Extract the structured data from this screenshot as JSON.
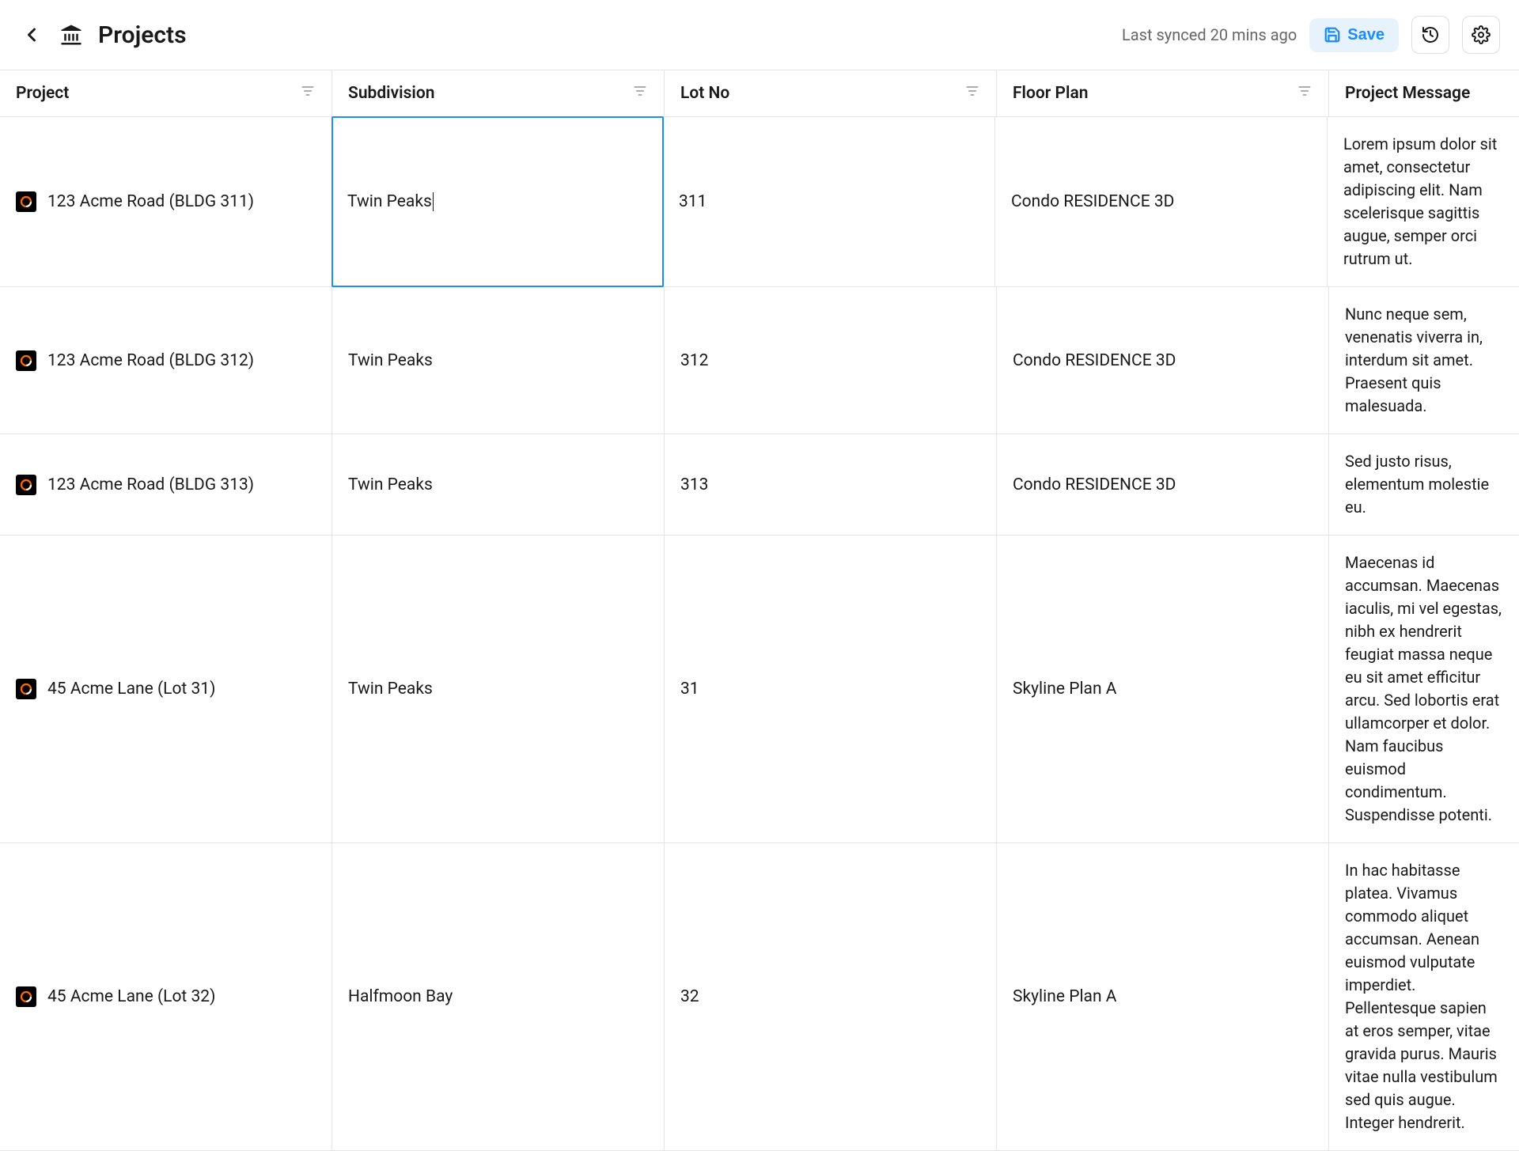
{
  "header": {
    "title": "Projects",
    "sync_text": "Last synced 20 mins ago",
    "save_label": "Save"
  },
  "columns": {
    "project": "Project",
    "subdivision": "Subdivision",
    "lotno": "Lot No",
    "floorplan": "Floor Plan",
    "message": "Project Message"
  },
  "rows": [
    {
      "project": "123 Acme Road (BLDG 311)",
      "subdivision": "Twin Peaks",
      "lotno": "311",
      "floorplan": "Condo RESIDENCE 3D",
      "message": "Lorem ipsum dolor sit amet, consectetur adipiscing elit. Nam scelerisque sagittis augue, semper orci rutrum ut."
    },
    {
      "project": "123 Acme Road (BLDG 312)",
      "subdivision": "Twin Peaks",
      "lotno": "312",
      "floorplan": "Condo RESIDENCE 3D",
      "message": "Nunc neque sem, venenatis viverra in, interdum sit amet. Praesent quis malesuada."
    },
    {
      "project": "123 Acme Road (BLDG 313)",
      "subdivision": "Twin Peaks",
      "lotno": "313",
      "floorplan": "Condo RESIDENCE 3D",
      "message": "Sed justo risus, elementum molestie eu."
    },
    {
      "project": "45 Acme Lane (Lot 31)",
      "subdivision": "Twin Peaks",
      "lotno": "31",
      "floorplan": "Skyline Plan A",
      "message": "Maecenas id accumsan. Maecenas iaculis, mi vel egestas, nibh ex hendrerit feugiat massa neque eu sit amet efficitur arcu. Sed lobortis erat ullamcorper et dolor. Nam faucibus euismod condimentum. Suspendisse potenti."
    },
    {
      "project": "45 Acme Lane (Lot 32)",
      "subdivision": "Halfmoon Bay",
      "lotno": "32",
      "floorplan": "Skyline Plan A",
      "message": "In hac habitasse platea. Vivamus commodo aliquet accumsan. Aenean euismod vulputate imperdiet. Pellentesque sapien at eros semper, vitae gravida purus. Mauris vitae nulla vestibulum sed quis augue. Integer hendrerit."
    }
  ]
}
